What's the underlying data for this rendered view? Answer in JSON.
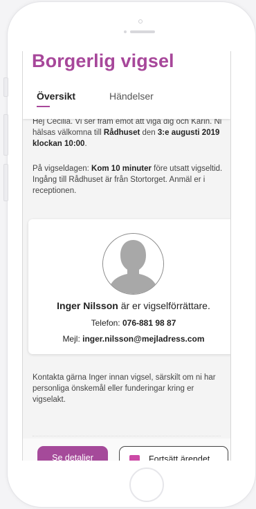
{
  "page": {
    "title": "Borgerlig vigsel",
    "accent_color": "#a7479a"
  },
  "tabs": [
    {
      "label": "Översikt",
      "active": true
    },
    {
      "label": "Händelser",
      "active": false
    }
  ],
  "intro": {
    "t1": "Hej Cecilia. Vi ser fram emot att viga dig och Karin. Ni hälsas välkomna till ",
    "place": "Rådhuset",
    "t2": " den ",
    "datetime": "3:e augusti 2019 klockan 10:00",
    "t3": "."
  },
  "arrival": {
    "t1": "På vigseldagen: ",
    "time": "Kom 10 minuter",
    "t2": " före utsatt vigseltid. Ingång till Rådhuset är från Stortorget. Anmäl er i receptionen."
  },
  "officiant": {
    "avatar_icon": "person-silhouette-icon",
    "name": "Inger Nilsson",
    "role_text": " är er vigselförrättare.",
    "phone_label": "Telefon: ",
    "phone": "076-881 98 87",
    "email_label": "Mejl: ",
    "email": "inger.nilsson@mejladress.com"
  },
  "contact_note": "Kontakta gärna Inger innan vigsel, särskilt om ni har personliga önskemål eller funderingar kring er vigselakt.",
  "actions": {
    "details_label": "Se detaljer",
    "continue_label": "Fortsätt ärendet",
    "continue_icon_color": "#cc4aa6"
  }
}
